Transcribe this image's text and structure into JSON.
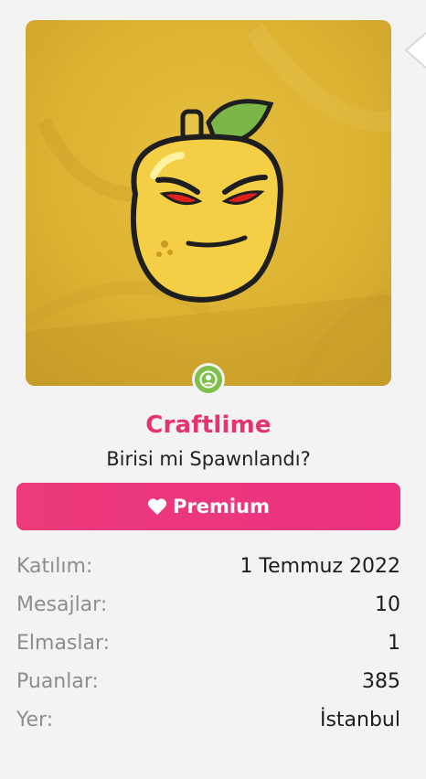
{
  "profile": {
    "username": "Craftlime",
    "title": "Birisi mi Spawnlandı?",
    "avatar_icon": "angry-lemon-mascot",
    "online_icon": "user-online-icon"
  },
  "premium": {
    "label": "Premium",
    "icon": "heart-icon"
  },
  "stats": [
    {
      "label": "Katılım:",
      "value": "1 Temmuz 2022"
    },
    {
      "label": "Mesajlar:",
      "value": "10"
    },
    {
      "label": "Elmaslar:",
      "value": "1"
    },
    {
      "label": "Puanlar:",
      "value": "385"
    },
    {
      "label": "Yer:",
      "value": "İstanbul"
    }
  ],
  "colors": {
    "accent": "#e5336d",
    "premium_bg": "#ec3a7a",
    "avatar_bg": "#dcb232",
    "online": "#7ec04a"
  }
}
